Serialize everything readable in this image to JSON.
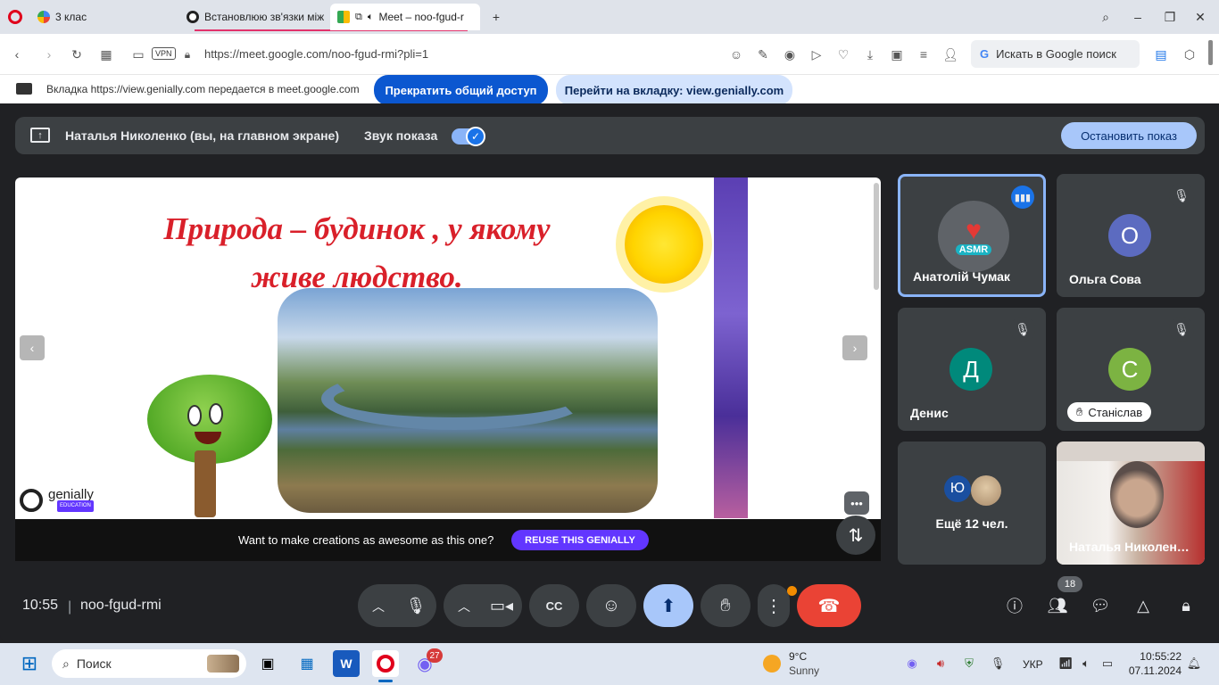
{
  "browser": {
    "tabs": [
      {
        "label": "3 клас"
      },
      {
        "label": "Встановлюю зв'язки між"
      },
      {
        "label": "Meet – noo-fgud-r"
      }
    ],
    "url": "https://meet.google.com/noo-fgud-rmi?pli=1",
    "vpn_label": "VPN",
    "search_label": "Искать в Google поиск"
  },
  "share_banner": {
    "message": "Вкладка https://view.genially.com передается в meet.google.com",
    "stop_label": "Прекратить общий доступ",
    "goto_label": "Перейти на вкладку: view.genially.com"
  },
  "presentation_bar": {
    "presenter": "Наталья Николенко (вы, на главном экране)",
    "sound_label": "Звук показа",
    "sound_on": true,
    "stop_label": "Остановить показ"
  },
  "slide": {
    "title": "Природа – будинок , у якому живе людство.",
    "logo_text": "genially",
    "logo_sub": "EDUCATION",
    "footer_text": "Want to make creations as awesome as this one?",
    "reuse_label": "REUSE THIS GENIALLY"
  },
  "participants": [
    {
      "name": "Анатолій Чумак",
      "initial": "",
      "speaking": true,
      "avatar_text": "ASMR"
    },
    {
      "name": "Ольга Сова",
      "initial": "О",
      "color": "#5c6bc0"
    },
    {
      "name": "Денис",
      "initial": "Д",
      "color": "#00897b"
    },
    {
      "name": "Станіслав",
      "initial": "С",
      "color": "#7cb342"
    },
    {
      "name": "Ещё 12 чел.",
      "initial": "Ю",
      "color": "#1a4fa0"
    },
    {
      "name": "Наталья Николен…"
    }
  ],
  "controls": {
    "time": "10:55",
    "meeting_code": "noo-fgud-rmi",
    "people_count": "18"
  },
  "taskbar": {
    "search_placeholder": "Поиск",
    "viber_badge": "27",
    "weather_temp": "9°C",
    "weather_desc": "Sunny",
    "lang": "УКР",
    "time": "10:55:22",
    "date": "07.11.2024"
  },
  "colors": {
    "accent": "#0b57d0",
    "end_call": "#ea4335",
    "meet_bg": "#202124",
    "tile_bg": "#3c4043",
    "reuse": "#6236ff"
  }
}
